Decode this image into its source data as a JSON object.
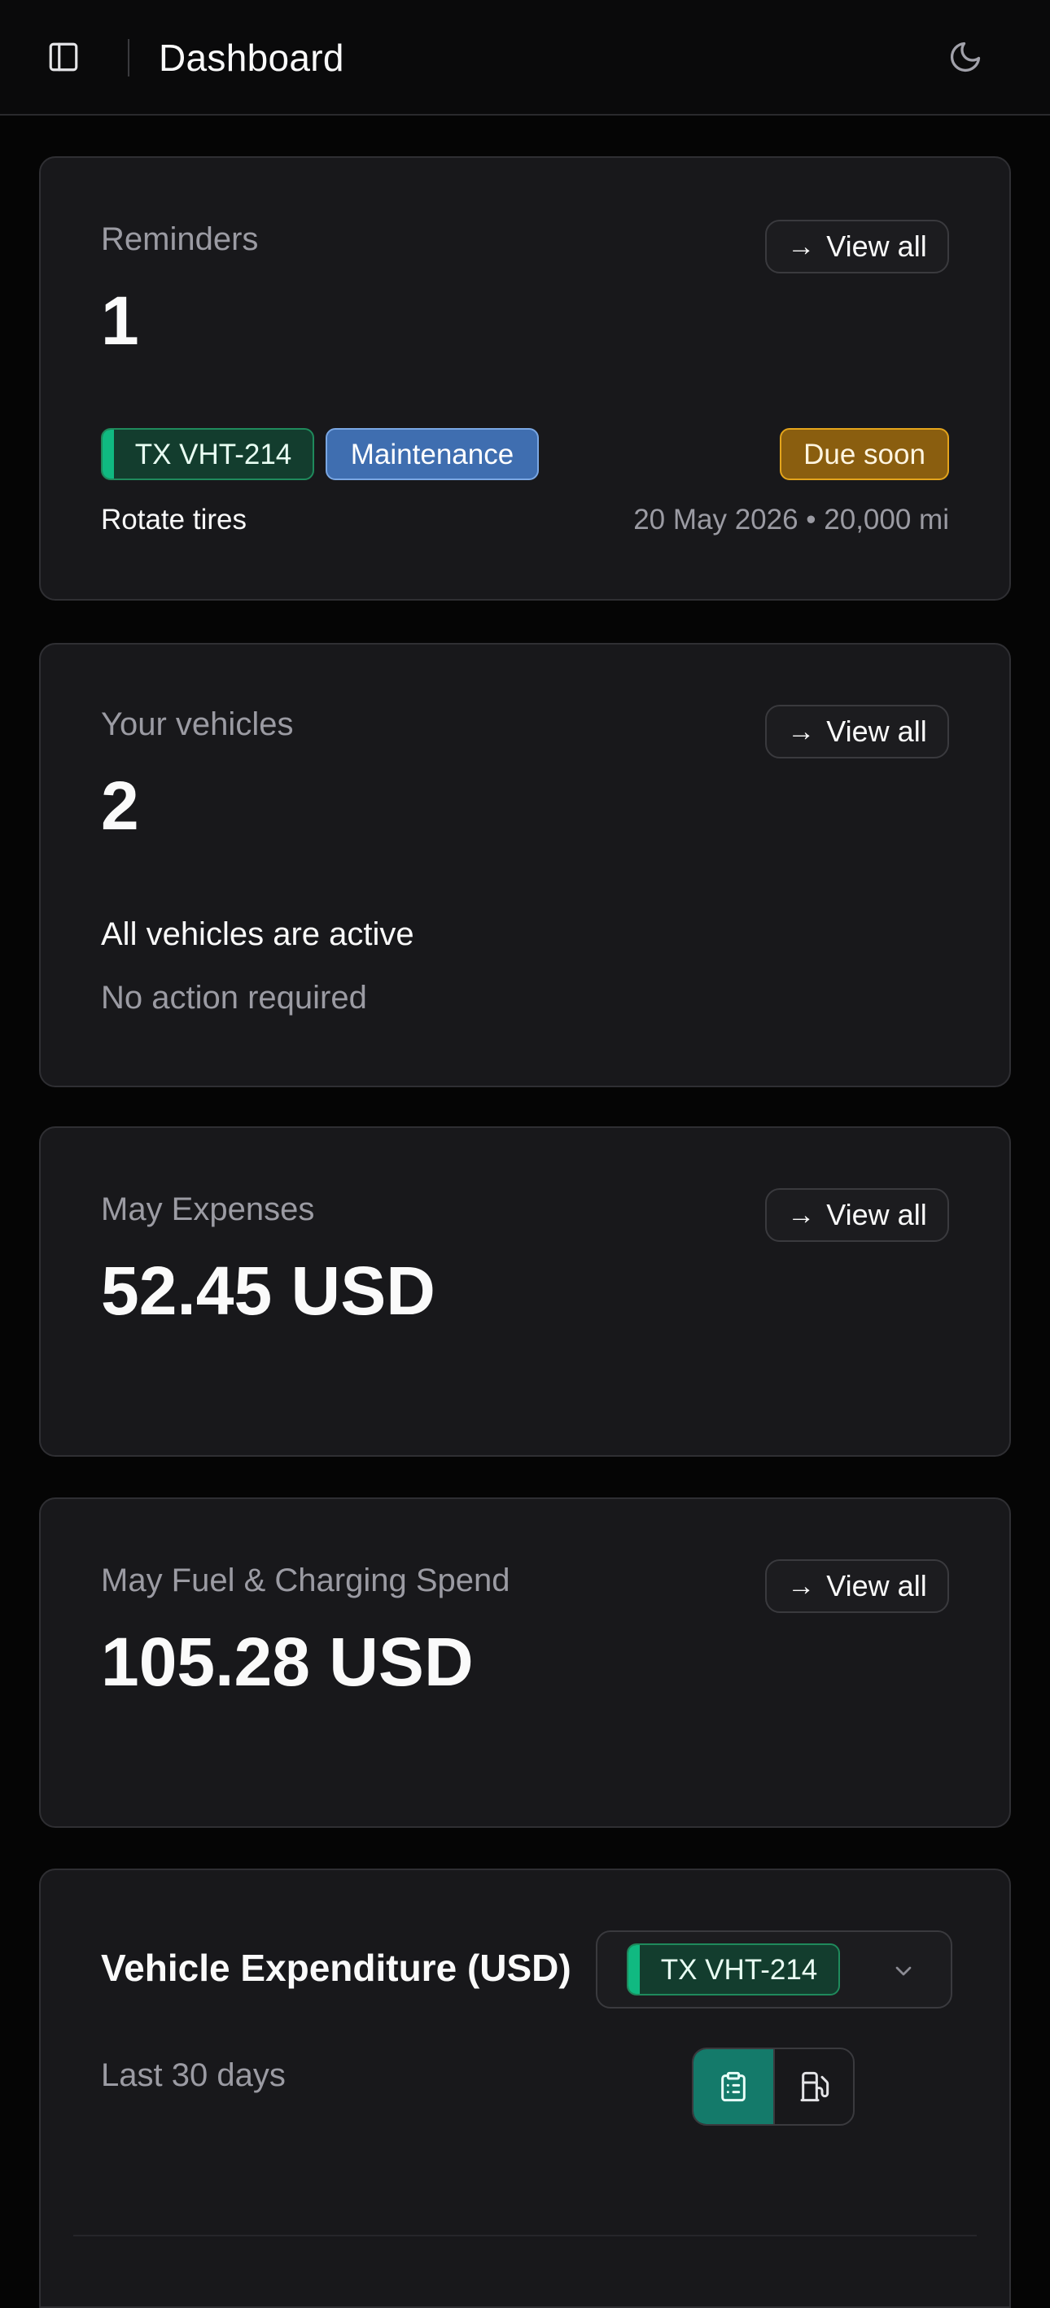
{
  "header": {
    "sidebar_icon": "sidebar-toggle-icon",
    "title": "Dashboard",
    "theme_icon": "moon-icon"
  },
  "reminders": {
    "label": "Reminders",
    "count": "1",
    "view_all": "View all",
    "item": {
      "plate": "TX VHT-214",
      "category": "Maintenance",
      "status": "Due soon",
      "task": "Rotate tires",
      "due": "20 May 2026 • 20,000 mi"
    }
  },
  "vehicles": {
    "label": "Your vehicles",
    "count": "2",
    "view_all": "View all",
    "status_title": "All vehicles are active",
    "status_sub": "No action required"
  },
  "expenses": {
    "label": "May Expenses",
    "amount": "52.45 USD",
    "view_all": "View all"
  },
  "fuel": {
    "label": "May Fuel & Charging Spend",
    "amount": "105.28 USD",
    "view_all": "View all"
  },
  "expenditure": {
    "title": "Vehicle Expenditure (USD)",
    "vehicle_selected": "TX VHT-214",
    "period": "Last 30 days",
    "toggle_options": [
      "clipboard-list-icon",
      "fuel-pump-icon"
    ],
    "toggle_active": "clipboard-list-icon"
  },
  "colors": {
    "background": "#050505",
    "card": "#18181b",
    "accent_green": "#10b981",
    "maintenance_blue": "#3f6eb0",
    "due_amber": "#e3a41c",
    "toggle_active": "#147a6a"
  }
}
